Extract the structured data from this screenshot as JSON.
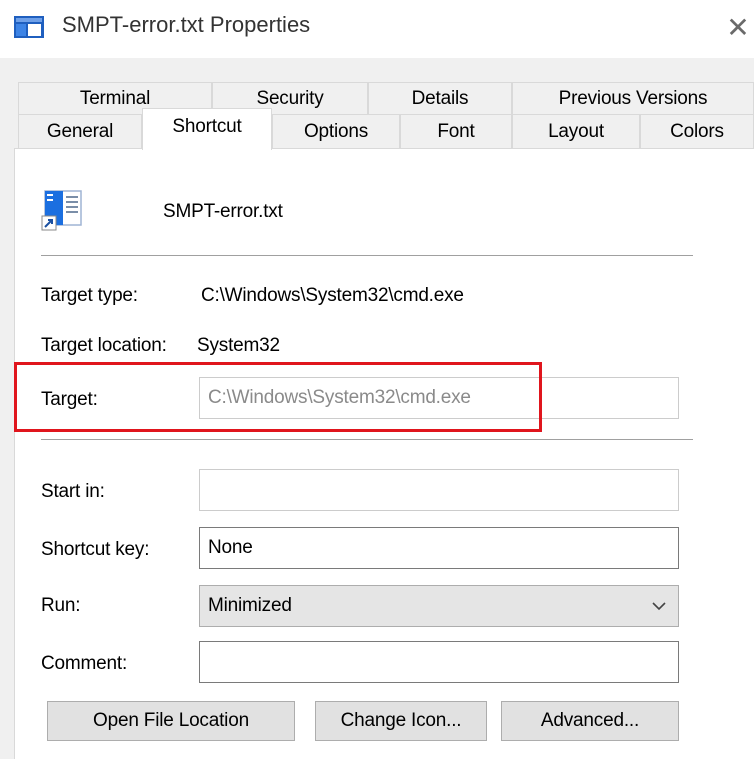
{
  "window": {
    "title": "SMPT-error.txt Properties",
    "close_glyph": "✕"
  },
  "tabs": {
    "row1": [
      {
        "label": "Terminal"
      },
      {
        "label": "Security"
      },
      {
        "label": "Details"
      },
      {
        "label": "Previous Versions"
      }
    ],
    "row2": [
      {
        "label": "General"
      },
      {
        "label": "Shortcut",
        "active": true
      },
      {
        "label": "Options"
      },
      {
        "label": "Font"
      },
      {
        "label": "Layout"
      },
      {
        "label": "Colors"
      }
    ]
  },
  "shortcut": {
    "file_name": "SMPT-error.txt",
    "file_icon": "shortcut-document-icon",
    "target_type_label": "Target type:",
    "target_type_value": "C:\\Windows\\System32\\cmd.exe",
    "target_location_label": "Target location:",
    "target_location_value": "System32",
    "target_label": "Target:",
    "target_value": "C:\\Windows\\System32\\cmd.exe",
    "start_in_label": "Start in:",
    "start_in_value": "",
    "shortcut_key_label": "Shortcut key:",
    "shortcut_key_value": "None",
    "run_label": "Run:",
    "run_value": "Minimized",
    "comment_label": "Comment:",
    "comment_value": ""
  },
  "buttons": {
    "open_file_location": "Open File Location",
    "change_icon": "Change Icon...",
    "advanced": "Advanced..."
  },
  "colors": {
    "highlight": "#e0151d",
    "dialog_bg": "#f0f0f0",
    "icon_blue": "#0a64d8"
  }
}
